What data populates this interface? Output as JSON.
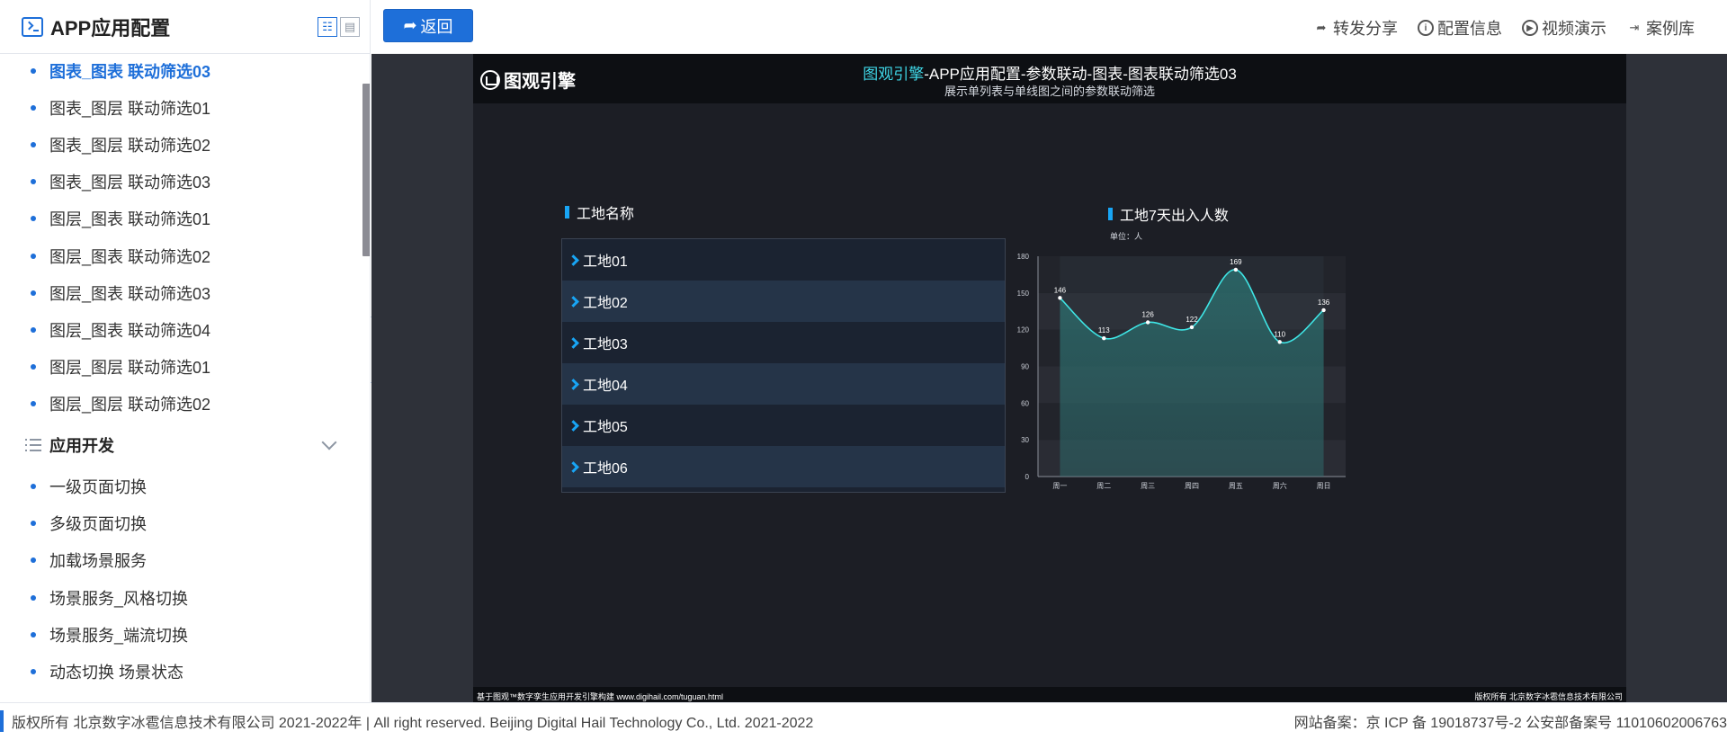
{
  "sidebar": {
    "title": "APP应用配置",
    "items_top": [
      {
        "label": "图表_图表 联动筛选03",
        "active": true
      },
      {
        "label": "图表_图层 联动筛选01"
      },
      {
        "label": "图表_图层 联动筛选02"
      },
      {
        "label": "图表_图层 联动筛选03"
      },
      {
        "label": "图层_图表 联动筛选01"
      },
      {
        "label": "图层_图表 联动筛选02"
      },
      {
        "label": "图层_图表 联动筛选03"
      },
      {
        "label": "图层_图表 联动筛选04"
      },
      {
        "label": "图层_图层 联动筛选01"
      },
      {
        "label": "图层_图层 联动筛选02"
      }
    ],
    "group": {
      "label": "应用开发",
      "icon": "list-icon"
    },
    "items_group": [
      {
        "label": "一级页面切换"
      },
      {
        "label": "多级页面切换"
      },
      {
        "label": "加载场景服务"
      },
      {
        "label": "场景服务_风格切换"
      },
      {
        "label": "场景服务_端流切换"
      },
      {
        "label": "动态切换 场景状态"
      }
    ]
  },
  "topbar": {
    "back_label": "返回",
    "links": [
      {
        "label": "转发分享",
        "icon": "share-icon"
      },
      {
        "label": "配置信息",
        "icon": "info-icon"
      },
      {
        "label": "视频演示",
        "icon": "play-icon"
      },
      {
        "label": "案例库",
        "icon": "login-icon"
      }
    ]
  },
  "screen": {
    "brand": "图观引擎",
    "title_highlight": "图观引擎",
    "title_rest": "-APP应用配置-参数联动-图表-图表联动筛选03",
    "subtitle": "展示单列表与单线图之间的参数联动筛选",
    "left_panel_title": "工地名称",
    "sites": [
      "工地01",
      "工地02",
      "工地03",
      "工地04",
      "工地05",
      "工地06"
    ],
    "right_panel_title": "工地7天出入人数",
    "unit_label": "单位：人",
    "footer_left": "基于图观™数字孪生应用开发引擎构建 www.digihail.com/tuguan.html",
    "footer_right": "版权所有 北京数字冰雹信息技术有限公司"
  },
  "chart_data": {
    "type": "area",
    "title": "工地7天出入人数",
    "categories": [
      "周一",
      "周二",
      "周三",
      "周四",
      "周五",
      "周六",
      "周日"
    ],
    "values": [
      146,
      113,
      126,
      122,
      169,
      110,
      136
    ],
    "ylim": [
      0,
      180
    ],
    "yticks": [
      0,
      30,
      60,
      90,
      120,
      150,
      180
    ],
    "grid": true,
    "smooth": true,
    "line_color": "#3fe6e6",
    "fill_color": "#2b6b6b"
  },
  "footer": {
    "copyright": "版权所有 北京数字冰雹信息技术有限公司 2021-2022年 | All right reserved. Beijing Digital Hail Technology Co., Ltd. 2021-2022",
    "icp": "网站备案：京 ICP 备 19018737号-2 公安部备案号 11010602006763"
  },
  "colors": {
    "accent": "#1e6fd9",
    "highlight": "#3fd6e6",
    "panel_bar": "#18a5f5"
  }
}
